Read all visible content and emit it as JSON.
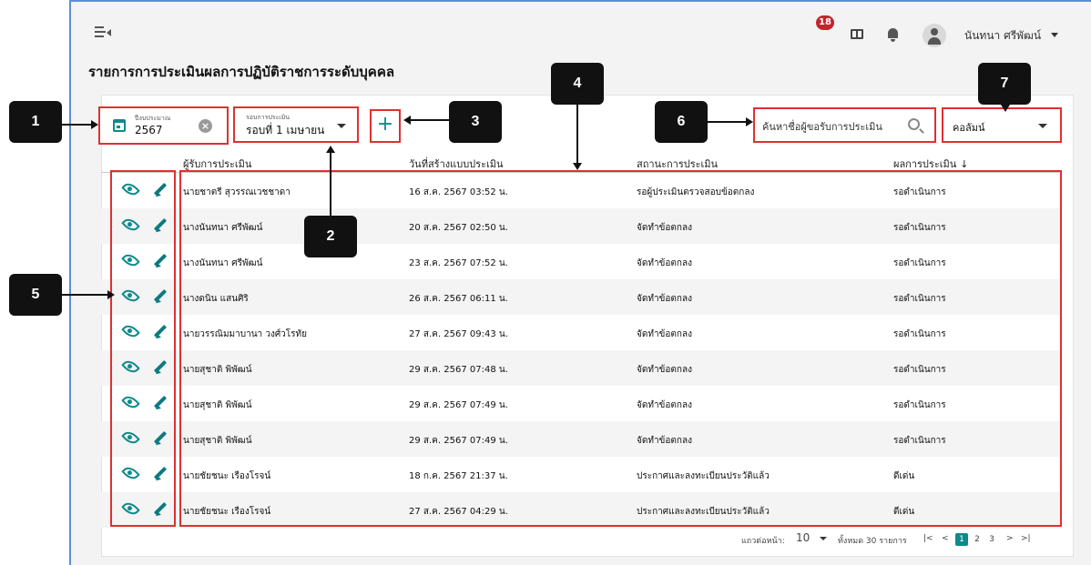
{
  "header": {
    "notification_count": "18",
    "user_name": "นันทนา ศรีพัฒน์"
  },
  "page": {
    "title": "รายการการประเมินผลการปฏิบัติราชการระดับบุคคล"
  },
  "filters": {
    "year_label": "ปีงบประมาณ",
    "year_value": "2567",
    "round_label": "รอบการประเมิน",
    "round_value": "รอบที่ 1 เมษายน",
    "add_symbol": "+",
    "search_placeholder": "ค้นหาชื่อผู้ขอรับการประเมิน",
    "column_label": "คอลัมน์"
  },
  "table": {
    "headers": [
      "ผู้รับการประเมิน",
      "วันที่สร้างแบบประเมิน",
      "สถานะการประเมิน",
      "ผลการประเมิน"
    ],
    "sort_indicator": "↓",
    "rows": [
      [
        "นายชาตรี สุวรรณเวชชาดา",
        "16 ส.ค. 2567 03:52 น.",
        "รอผู้ประเมินตรวจสอบข้อตกลง",
        "รอดำเนินการ"
      ],
      [
        "นางนันทนา ศรีพัฒน์",
        "20 ส.ค. 2567 02:50 น.",
        "จัดทำข้อตกลง",
        "รอดำเนินการ"
      ],
      [
        "นางนันทนา ศรีพัฒน์",
        "23 ส.ค. 2567 07:52 น.",
        "จัดทำข้อตกลง",
        "รอดำเนินการ"
      ],
      [
        "นางดนิน แสนศิริ",
        "26 ส.ค. 2567 06:11 น.",
        "จัดทำข้อตกลง",
        "รอดำเนินการ"
      ],
      [
        "นายวรรณิมมาบานา วงศ์วโรทัย",
        "27 ส.ค. 2567 09:43 น.",
        "จัดทำข้อตกลง",
        "รอดำเนินการ"
      ],
      [
        "นายสุชาติ พิพัฒน์",
        "29 ส.ค. 2567 07:48 น.",
        "จัดทำข้อตกลง",
        "รอดำเนินการ"
      ],
      [
        "นายสุชาติ พิพัฒน์",
        "29 ส.ค. 2567 07:49 น.",
        "จัดทำข้อตกลง",
        "รอดำเนินการ"
      ],
      [
        "นายสุชาติ พิพัฒน์",
        "29 ส.ค. 2567 07:49 น.",
        "จัดทำข้อตกลง",
        "รอดำเนินการ"
      ],
      [
        "นายชัยชนะ เรืองโรจน์",
        "18 ก.ค. 2567 21:37 น.",
        "ประกาศและลงทะเบียนประวัติแล้ว",
        "ดีเด่น"
      ],
      [
        "นายชัยชนะ เรืองโรจน์",
        "27 ส.ค. 2567 04:29 น.",
        "ประกาศและลงทะเบียนประวัติแล้ว",
        "ดีเด่น"
      ]
    ]
  },
  "pagination": {
    "rows_per_page_label": "แถวต่อหน้า:",
    "rows_per_page_value": "10",
    "total_label": "ทั้งหมด 30 รายการ",
    "first": "|<",
    "prev": "<",
    "pages": [
      "1",
      "2",
      "3"
    ],
    "current_page": "1",
    "next": ">",
    "last": ">|"
  },
  "annotations": [
    "1",
    "2",
    "3",
    "4",
    "5",
    "6",
    "7"
  ],
  "colors": {
    "accent": "#0f8a8c",
    "annotation_box": "#e03030",
    "badge": "#c0272d",
    "window_border": "#5b8fd6"
  }
}
